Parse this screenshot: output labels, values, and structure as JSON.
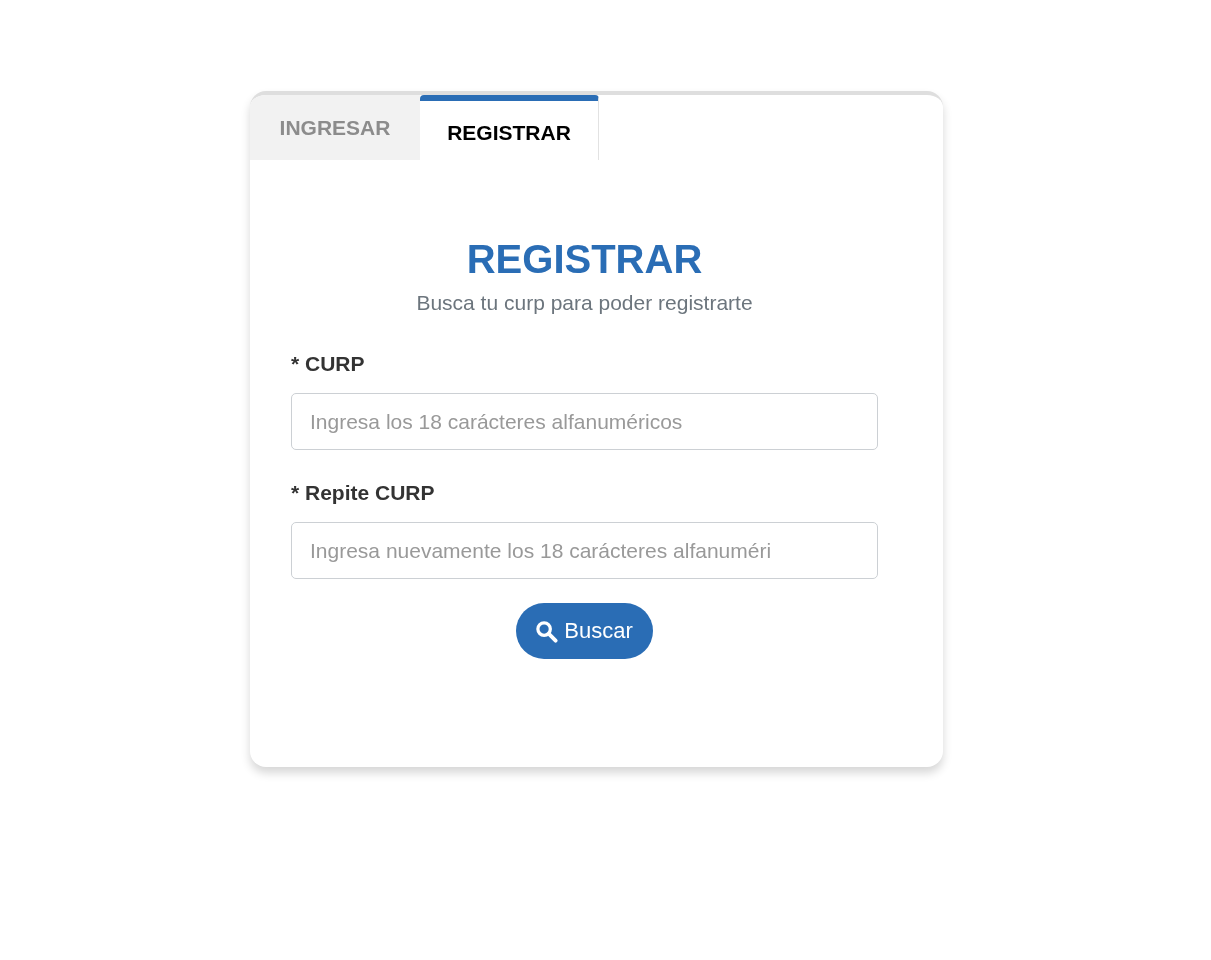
{
  "tabs": [
    {
      "label": "INGRESAR",
      "selected": false
    },
    {
      "label": "REGISTRAR",
      "selected": true
    }
  ],
  "form": {
    "title": "REGISTRAR",
    "subtitle": "Busca tu curp para poder registrarte",
    "fields": [
      {
        "label": "* CURP",
        "placeholder": "Ingresa los 18 carácteres alfanuméricos"
      },
      {
        "label": "* Repite CURP",
        "placeholder": "Ingresa nuevamente los 18 carácteres alfanuméri"
      }
    ],
    "button": {
      "label": "Buscar"
    }
  }
}
